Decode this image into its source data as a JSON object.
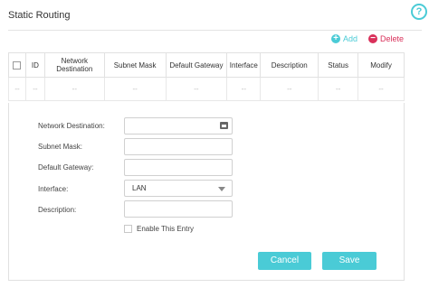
{
  "page": {
    "title": "Static Routing"
  },
  "toolbar": {
    "add_label": "Add",
    "delete_label": "Delete"
  },
  "table": {
    "headers": [
      "ID",
      "Network Destination",
      "Subnet Mask",
      "Default Gateway",
      "Interface",
      "Description",
      "Status",
      "Modify"
    ],
    "row": [
      "--",
      "--",
      "--",
      "--",
      "--",
      "--",
      "--",
      "--",
      "--"
    ]
  },
  "form": {
    "network_destination_label": "Network Destination:",
    "subnet_mask_label": "Subnet Mask:",
    "default_gateway_label": "Default Gateway:",
    "interface_label": "Interface:",
    "interface_value": "LAN",
    "description_label": "Description:",
    "enable_label": "Enable This Entry",
    "cancel_label": "Cancel",
    "save_label": "Save"
  },
  "colors": {
    "accent": "#4acbd6",
    "delete": "#d9305a"
  }
}
